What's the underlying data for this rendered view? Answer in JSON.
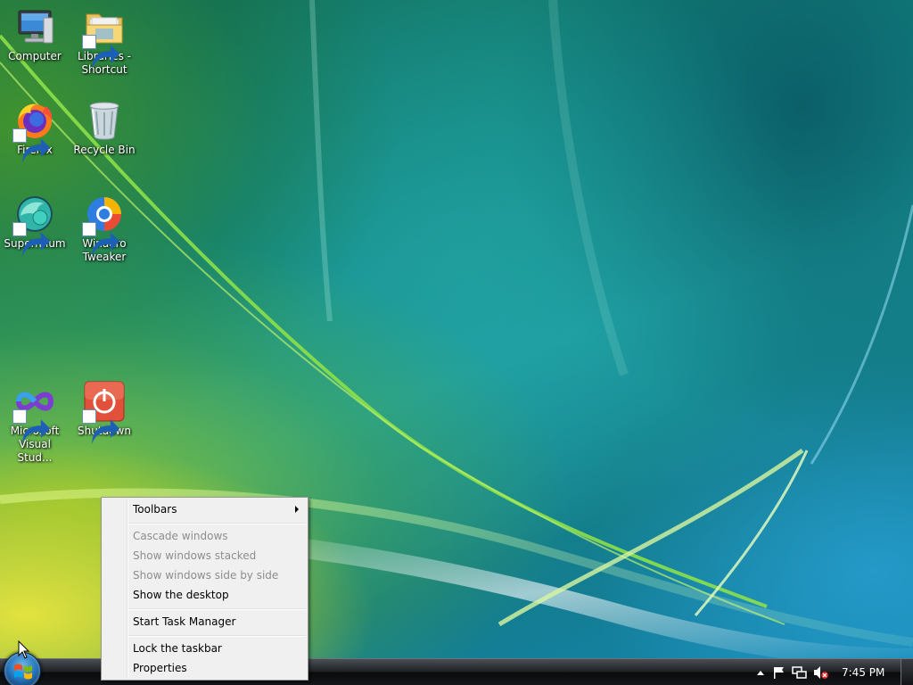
{
  "desktop": {
    "icons": [
      {
        "label": "Computer",
        "icon": "computer-icon"
      },
      {
        "label": "Libraries -\nShortcut",
        "icon": "libraries-folder-icon"
      },
      {
        "label": "Firefox",
        "icon": "firefox-icon"
      },
      {
        "label": "Recycle Bin",
        "icon": "recycle-bin-icon"
      },
      {
        "label": "Supermium",
        "icon": "supermium-icon"
      },
      {
        "label": "Winaero\nTweaker",
        "icon": "winaero-tweaker-icon"
      },
      {
        "label": "Microsoft\nVisual Stud...",
        "icon": "visual-studio-icon"
      },
      {
        "label": "Shutdown",
        "icon": "shutdown-icon"
      }
    ]
  },
  "context_menu": {
    "items": [
      {
        "label": "Toolbars",
        "enabled": true,
        "submenu": true
      },
      {
        "label": "Cascade windows",
        "enabled": false
      },
      {
        "label": "Show windows stacked",
        "enabled": false
      },
      {
        "label": "Show windows side by side",
        "enabled": false
      },
      {
        "label": "Show the desktop",
        "enabled": true
      },
      {
        "label": "Start Task Manager",
        "enabled": true
      },
      {
        "label": "Lock the taskbar",
        "enabled": true
      },
      {
        "label": "Properties",
        "enabled": true
      }
    ]
  },
  "taskbar": {
    "start_button": "windows-start-orb-icon",
    "tray_icons": [
      "show-hidden-icons-icon",
      "action-center-flag-icon",
      "network-icon",
      "volume-muted-icon"
    ],
    "clock": "7:45 PM"
  },
  "colors": {
    "taskbar": "#1e2124",
    "menu_background": "#f0f0f0",
    "menu_disabled_text": "#8d8d8d",
    "label_text": "#ffffff"
  }
}
